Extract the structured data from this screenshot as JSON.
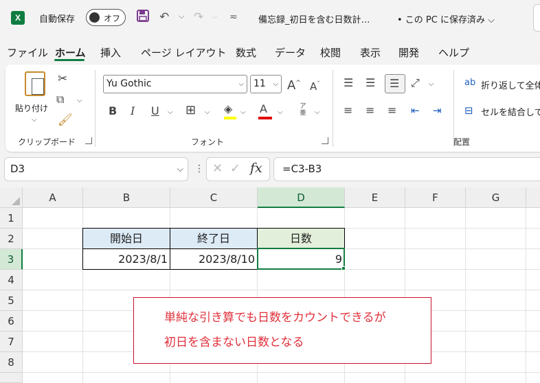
{
  "app": {
    "logo_letter": "X",
    "autosave_label": "自動保存",
    "autosave_state": "オフ",
    "filename": "備忘録_初日を含む日数計…",
    "save_status": "• この PC に保存済み ⌵"
  },
  "menu": {
    "tabs": [
      "ファイル",
      "ホーム",
      "挿入",
      "ページ レイアウト",
      "数式",
      "データ",
      "校閲",
      "表示",
      "開発",
      "ヘルプ"
    ],
    "active": "ホーム"
  },
  "ribbon": {
    "clipboard": {
      "paste_label": "貼り付け",
      "group_label": "クリップボード"
    },
    "font": {
      "font_name": "Yu Gothic",
      "font_size": "11",
      "group_label": "フォント",
      "grow": "A",
      "shrink": "A",
      "bold": "B",
      "italic": "I",
      "underline": "U",
      "font_color": "A",
      "phonetic": "ア亜"
    },
    "alignment": {
      "wrap_text": "折り返して全体",
      "merge_center": "セルを結合して",
      "group_label": "配置"
    }
  },
  "formula_bar": {
    "name_box": "D3",
    "fx": "fx",
    "formula": "=C3-B3"
  },
  "sheet": {
    "columns": [
      "A",
      "B",
      "C",
      "D",
      "E",
      "F",
      "G"
    ],
    "rows": [
      "1",
      "2",
      "3",
      "4",
      "5",
      "6",
      "7",
      "8"
    ],
    "selected_column": "D",
    "selected_row": "3",
    "cells": {
      "B2": "開始日",
      "C2": "終了日",
      "D2": "日数",
      "B3": "2023/8/1",
      "C3": "2023/8/10",
      "D3": "9"
    }
  },
  "callout": {
    "line1": "単純な引き算でも日数をカウントできるが",
    "line2": "初日を含まない日数となる"
  },
  "colors": {
    "accent": "#107c41",
    "header_blue": "#ddebf7",
    "header_green": "#e2efda",
    "callout_text": "#e0303b",
    "callout_border": "#c8102e"
  }
}
